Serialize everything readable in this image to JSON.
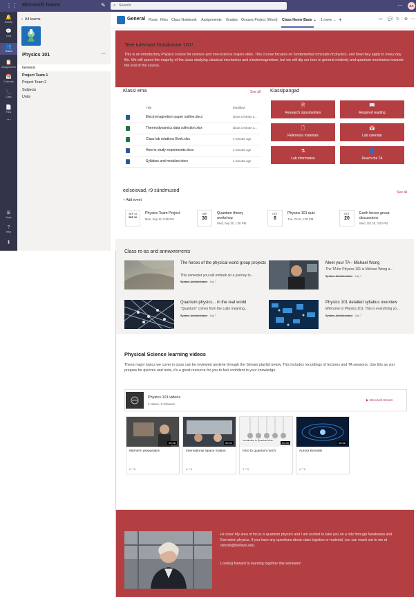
{
  "app": {
    "name": "Microsoft Teams",
    "search_placeholder": "Search",
    "avatar": "SA"
  },
  "rail": [
    {
      "icon": "activity-icon",
      "glyph": "🔔",
      "label": "Activity"
    },
    {
      "icon": "chat-icon",
      "glyph": "💬",
      "label": "Chat"
    },
    {
      "icon": "teams-icon",
      "glyph": "👥",
      "label": "Teams"
    },
    {
      "icon": "assignments-icon",
      "glyph": "📋",
      "label": "Assignments"
    },
    {
      "icon": "calendar-icon",
      "glyph": "📅",
      "label": "Calendar"
    },
    {
      "icon": "calls-icon",
      "glyph": "📞",
      "label": "Calls"
    },
    {
      "icon": "files-icon",
      "glyph": "📄",
      "label": "Files"
    },
    {
      "icon": "more-icon",
      "glyph": "⋯",
      "label": ""
    },
    {
      "icon": "apps-icon",
      "glyph": "⊞",
      "label": "Apps"
    },
    {
      "icon": "help-icon",
      "glyph": "?",
      "label": "Help"
    },
    {
      "icon": "download-icon",
      "glyph": "⬇",
      "label": ""
    }
  ],
  "left": {
    "back": "All teams",
    "team_name": "Physics 101",
    "channels": [
      {
        "label": "General",
        "selected": true,
        "bold": false
      },
      {
        "label": "Project Team 1",
        "selected": false,
        "bold": true
      },
      {
        "label": "Project Team 2",
        "selected": false,
        "bold": false
      },
      {
        "label": "Subjects",
        "selected": false,
        "bold": false
      },
      {
        "label": "Units",
        "selected": false,
        "bold": false
      }
    ]
  },
  "channel": {
    "name": "General",
    "tabs": [
      "Posts",
      "Files",
      "Class Notebook",
      "Assignments",
      "Grades",
      "Oceans Project (Word)",
      "Class Home Base",
      "1 more"
    ],
    "active_tab": "Class Home Base"
  },
  "hero": {
    "title": "Tere tulemast füüsikasse 101!",
    "text": "This is an introductory Physics course for science and non-science majors alike. This course focuses on fundamental concepts of physics, and how they apply to every day life. We will spend the majority of the class studying classical mechanics and electromagnetism, but we will dip our toes in general relativity and quantum mechanics towards the end of the course."
  },
  "docs": {
    "title": "Klassi ema",
    "see_all": "See all",
    "col_title": "Title",
    "col_modified": "Modified",
    "rows": [
      {
        "name": "Electromagnetism paper outline.docx",
        "modified": "about a minute a...",
        "color": "#2b579a"
      },
      {
        "name": "Thermodynamics data collection.xlsx",
        "modified": "about a minute a...",
        "color": "#217346"
      },
      {
        "name": "Class lab rotations Book.xlsx",
        "modified": "4 minutes ago",
        "color": "#217346"
      },
      {
        "name": "How to study experiments.docx",
        "modified": "4 minutes ago",
        "color": "#2b579a"
      },
      {
        "name": "Syllabus and modules.docx",
        "modified": "4 minutes ago",
        "color": "#2b579a"
      }
    ]
  },
  "quick": {
    "title": "Klassipangad",
    "links": [
      {
        "label": "Research opportunities",
        "icon": "document-icon",
        "glyph": "🗎"
      },
      {
        "label": "Required reading",
        "icon": "book-icon",
        "glyph": "📖"
      },
      {
        "label": "Reference materials",
        "icon": "file-icon",
        "glyph": "🗋"
      },
      {
        "label": "Lab calendar",
        "icon": "calendar-icon",
        "glyph": "📅"
      },
      {
        "label": "Lab information",
        "icon": "flask-icon",
        "glyph": "⚗"
      },
      {
        "label": "Reach the TA",
        "icon": "person-icon",
        "glyph": "👤"
      }
    ]
  },
  "events": {
    "title": "eelseisvad, r9 sündmused",
    "see_all": "See all",
    "add": "Add event",
    "items": [
      {
        "month": "SEP 14",
        "day": "SEP 16",
        "title": "Physics Team Project",
        "date": "Mon, Sep 14, 5:00 PM"
      },
      {
        "month": "SEP",
        "day": "30",
        "title": "Quantum theory workshop",
        "date": "Wed, Sep 30, 1:00 PM"
      },
      {
        "month": "OCT",
        "day": "6",
        "title": "Physics 101 quiz",
        "date": "Tue, Oct 6, 1:00 PM"
      },
      {
        "month": "OCT",
        "day": "20",
        "title": "Earth forces group discussions",
        "date": "Wed, Oct 20, 3:00 PM"
      }
    ]
  },
  "news": {
    "title": "Class re-as and annwxrerrents",
    "items": [
      {
        "title": "The forces of the physical world group projects",
        "snippet": "This semester you will embark on a journey to...",
        "author": "System Administrator",
        "date": "July 7"
      },
      {
        "title": "Meet your TA - Michael Wong",
        "snippet": "The TA for Physics 101 is Michael Wong a...",
        "author": "System Administrator",
        "date": "July 7"
      },
      {
        "title": "Quantum physics... in the real world",
        "snippet": "\"Quantum\" comes from the Latin meaning...",
        "author": "System Administrator",
        "date": "July 7"
      },
      {
        "title": "Physics 101 detailed syllabus overview",
        "snippet": "Welcome to Physics 101. This is everything yo...",
        "author": "System Administrator",
        "date": "July 7"
      }
    ]
  },
  "videos": {
    "title": "Physical Science learning videos",
    "text": "These major topics we cover in class can be reviewed anytime through the Stream playlist below. This includes recordings of lectures and TA sessions. Use this as you prepare for quizzes and tests, it's a great resource for you to feel confident in your knowledge.",
    "channel_name": "Physics 101 videos",
    "channel_meta": "4 videos | 0 followers",
    "stream_label": "Microsoft Stream",
    "items": [
      {
        "name": "Mid-term preparation",
        "duration": "00:46",
        "stats": "0 ♡0",
        "caption": ""
      },
      {
        "name": "International Space Station",
        "duration": "00:31",
        "stats": "0 ♡0",
        "caption": ""
      },
      {
        "name": "Intro to quantum mech",
        "duration": "00:46",
        "stats": "0 ♡0",
        "caption": "Introduction to Quantum Mech"
      },
      {
        "name": "Aurora Borealis",
        "duration": "00:30",
        "stats": "0 ♡0",
        "caption": ""
      }
    ]
  },
  "footer": {
    "text": "Hi class! My area of focus is quantum physics and I am excited to take you on a ride through Newtonian and Esenstein physics. If you have any questions about class logistics or material, you can reach out to me at debrab@bellows.edu.",
    "text2": "Looking forward to learning together this semester!"
  }
}
